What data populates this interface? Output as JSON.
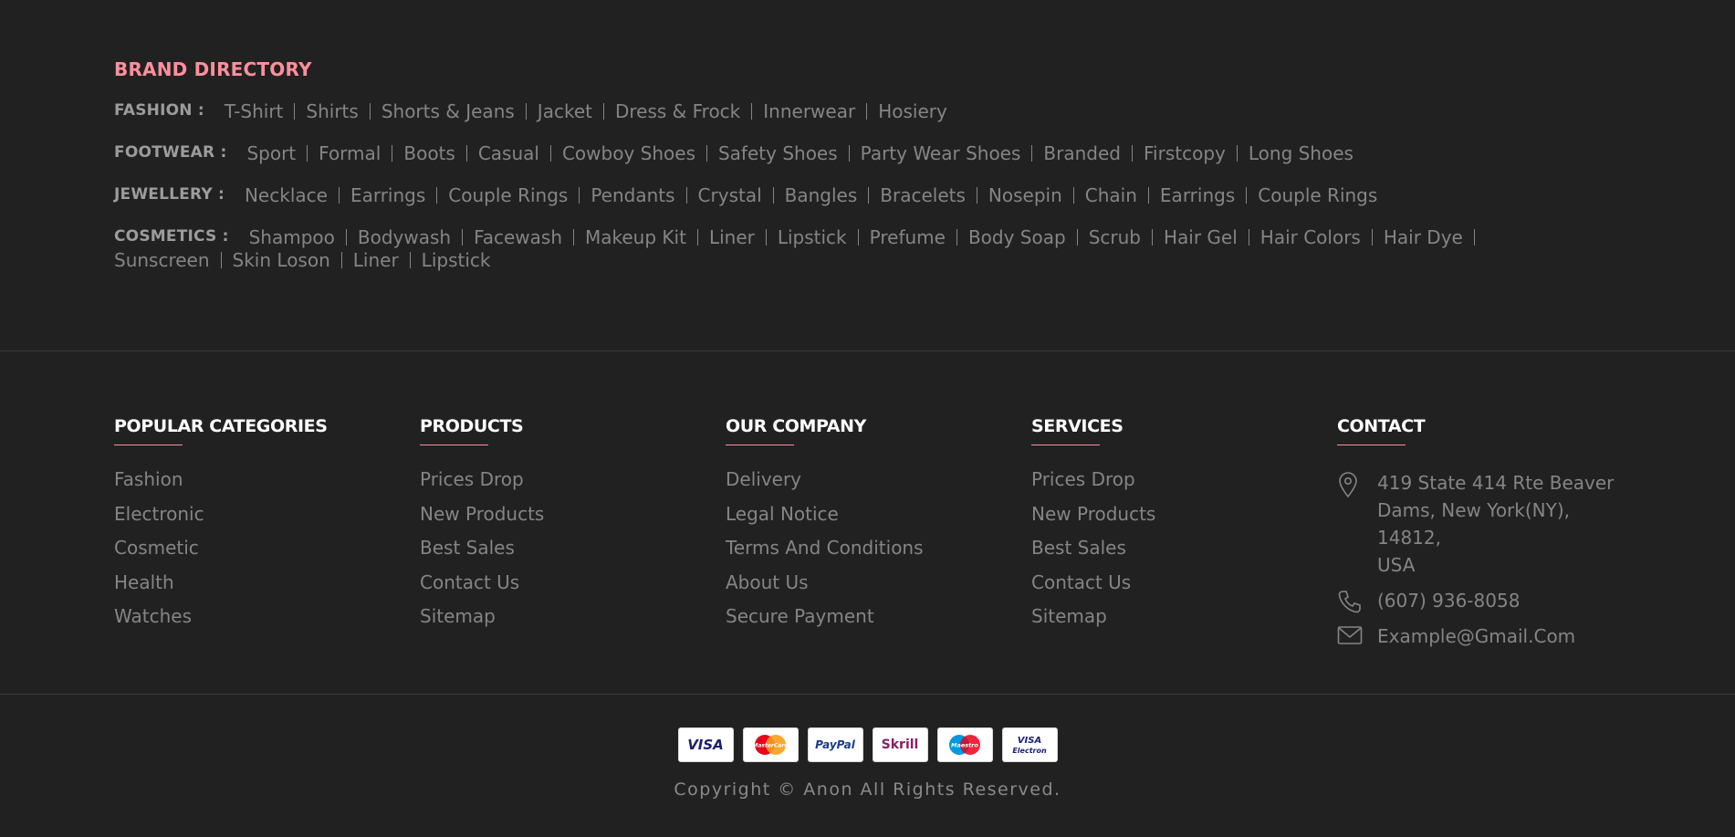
{
  "brand_directory": {
    "title": "BRAND DIRECTORY",
    "rows": [
      {
        "label": "FASHION :",
        "items": [
          "T-Shirt",
          "Shirts",
          "Shorts & Jeans",
          "Jacket",
          "Dress & Frock",
          "Innerwear",
          "Hosiery"
        ]
      },
      {
        "label": "FOOTWEAR :",
        "items": [
          "Sport",
          "Formal",
          "Boots",
          "Casual",
          "Cowboy Shoes",
          "Safety Shoes",
          "Party Wear Shoes",
          "Branded",
          "Firstcopy",
          "Long Shoes"
        ]
      },
      {
        "label": "JEWELLERY :",
        "items": [
          "Necklace",
          "Earrings",
          "Couple Rings",
          "Pendants",
          "Crystal",
          "Bangles",
          "Bracelets",
          "Nosepin",
          "Chain",
          "Earrings",
          "Couple Rings"
        ]
      },
      {
        "label": "COSMETICS :",
        "items": [
          "Shampoo",
          "Bodywash",
          "Facewash",
          "Makeup Kit",
          "Liner",
          "Lipstick",
          "Prefume",
          "Body Soap",
          "Scrub",
          "Hair Gel",
          "Hair Colors",
          "Hair Dye",
          "Sunscreen",
          "Skin Loson",
          "Liner",
          "Lipstick"
        ]
      }
    ]
  },
  "columns": [
    {
      "title": "POPULAR CATEGORIES",
      "items": [
        "Fashion",
        "Electronic",
        "Cosmetic",
        "Health",
        "Watches"
      ]
    },
    {
      "title": "PRODUCTS",
      "items": [
        "Prices Drop",
        "New Products",
        "Best Sales",
        "Contact Us",
        "Sitemap"
      ]
    },
    {
      "title": "OUR COMPANY",
      "items": [
        "Delivery",
        "Legal Notice",
        "Terms And Conditions",
        "About Us",
        "Secure Payment"
      ]
    },
    {
      "title": "SERVICES",
      "items": [
        "Prices Drop",
        "New Products",
        "Best Sales",
        "Contact Us",
        "Sitemap"
      ]
    }
  ],
  "contact": {
    "title": "CONTACT",
    "address_lines": [
      "419 State 414 Rte Beaver",
      "Dams, New York(NY), 14812,",
      "USA"
    ],
    "phone": "(607) 936-8058",
    "email": "Example@Gmail.Com",
    "icons": [
      "location-icon",
      "phone-icon",
      "mail-icon"
    ]
  },
  "payments": [
    "VISA",
    "MasterCard",
    "PayPal",
    "Skrill",
    "Maestro",
    "VISA Electron"
  ],
  "copyright": "Copyright © Anon All Rights Reserved.",
  "colors": {
    "background": "#212121",
    "accent": "#ff8f9c",
    "text": "#858585",
    "heading": "#ffffff"
  }
}
